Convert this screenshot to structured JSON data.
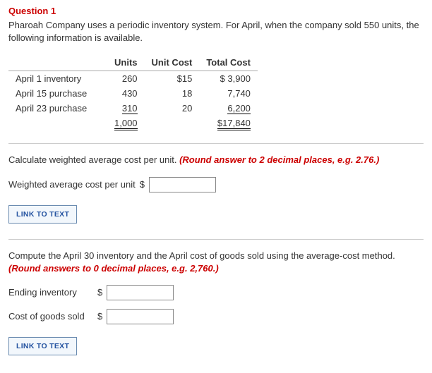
{
  "question": {
    "title": "Question 1",
    "text": "Pharoah Company uses a periodic inventory system. For April, when the company sold 550 units, the following information is available."
  },
  "table": {
    "headers": {
      "units": "Units",
      "unit_cost": "Unit Cost",
      "total_cost": "Total Cost"
    },
    "rows": [
      {
        "label": "April 1 inventory",
        "units": "260",
        "unit_cost": "$15",
        "total_cost": "$ 3,900"
      },
      {
        "label": "April 15 purchase",
        "units": "430",
        "unit_cost": "18",
        "total_cost": "7,740"
      },
      {
        "label": "April 23 purchase",
        "units": "310",
        "unit_cost": "20",
        "total_cost": "6,200"
      }
    ],
    "totals": {
      "units": "1,000",
      "total_cost": "$17,840"
    }
  },
  "part1": {
    "instruction_text": "Calculate weighted average cost per unit. ",
    "hint": "(Round answer to 2 decimal places, e.g. 2.76.)",
    "input_label": "Weighted average cost per unit",
    "currency": "$"
  },
  "part2": {
    "instruction_text": "Compute the April 30 inventory and the April cost of goods sold using the average-cost method. ",
    "hint": "(Round answers to 0 decimal places, e.g. 2,760.)",
    "ending_label": "Ending inventory",
    "cogs_label": "Cost of goods sold",
    "currency": "$"
  },
  "link_button": "LINK TO TEXT",
  "chart_data": {
    "type": "table",
    "columns": [
      "Item",
      "Units",
      "Unit Cost",
      "Total Cost"
    ],
    "rows": [
      [
        "April 1 inventory",
        260,
        15,
        3900
      ],
      [
        "April 15 purchase",
        430,
        18,
        7740
      ],
      [
        "April 23 purchase",
        310,
        20,
        6200
      ]
    ],
    "totals": {
      "Units": 1000,
      "Total Cost": 17840
    },
    "context": {
      "units_sold": 550,
      "company": "Pharoah Company",
      "method": "periodic inventory, average-cost"
    }
  }
}
